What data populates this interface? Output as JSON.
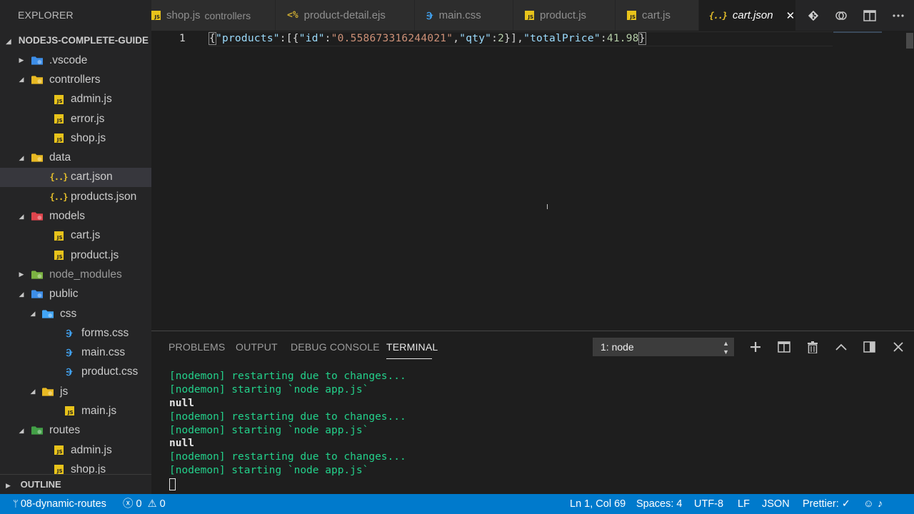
{
  "sidebar": {
    "title": "EXPLORER",
    "project": "NODEJS-COMPLETE-GUIDE",
    "outline": "OUTLINE",
    "items": [
      {
        "label": ".vscode",
        "kind": "folder-vscode",
        "icon": "vscode-folder-icon",
        "color": "#3d8ee8",
        "expanded": false
      },
      {
        "label": "controllers",
        "kind": "folder",
        "icon": "controllers-folder-icon",
        "color": "#e8b923",
        "expanded": true
      },
      {
        "label": "admin.js",
        "kind": "js",
        "icon": "js-file-icon"
      },
      {
        "label": "error.js",
        "kind": "js",
        "icon": "js-file-icon"
      },
      {
        "label": "shop.js",
        "kind": "js",
        "icon": "js-file-icon"
      },
      {
        "label": "data",
        "kind": "folder",
        "icon": "data-folder-icon",
        "color": "#e8b923",
        "expanded": true
      },
      {
        "label": "cart.json",
        "kind": "json",
        "icon": "json-file-icon",
        "selected": true
      },
      {
        "label": "products.json",
        "kind": "json",
        "icon": "json-file-icon"
      },
      {
        "label": "models",
        "kind": "folder",
        "icon": "models-folder-icon",
        "color": "#e0454d",
        "expanded": true
      },
      {
        "label": "cart.js",
        "kind": "js",
        "icon": "js-file-icon"
      },
      {
        "label": "product.js",
        "kind": "js",
        "icon": "js-file-icon"
      },
      {
        "label": "node_modules",
        "kind": "folder",
        "icon": "node-modules-folder-icon",
        "color": "#7cb342",
        "expanded": false,
        "dim": true
      },
      {
        "label": "public",
        "kind": "folder",
        "icon": "public-folder-icon",
        "color": "#3d8ee8",
        "expanded": true
      },
      {
        "label": "css",
        "kind": "folder",
        "icon": "css-folder-icon",
        "color": "#42a5f5",
        "expanded": true
      },
      {
        "label": "forms.css",
        "kind": "css",
        "icon": "css-file-icon"
      },
      {
        "label": "main.css",
        "kind": "css",
        "icon": "css-file-icon"
      },
      {
        "label": "product.css",
        "kind": "css",
        "icon": "css-file-icon"
      },
      {
        "label": "js",
        "kind": "folder",
        "icon": "js-folder-icon",
        "color": "#e8b923",
        "expanded": true
      },
      {
        "label": "main.js",
        "kind": "js",
        "icon": "js-file-icon"
      },
      {
        "label": "routes",
        "kind": "folder",
        "icon": "routes-folder-icon",
        "color": "#43a047",
        "expanded": true
      },
      {
        "label": "admin.js",
        "kind": "js",
        "icon": "js-file-icon"
      },
      {
        "label": "shop.js",
        "kind": "js",
        "icon": "js-file-icon"
      }
    ]
  },
  "tabs": [
    {
      "label": "shop.js",
      "sub": "controllers",
      "icon": "js-file-icon",
      "active": false
    },
    {
      "label": "product-detail.ejs",
      "icon": "ejs-file-icon",
      "active": false
    },
    {
      "label": "main.css",
      "icon": "css-file-icon",
      "active": false
    },
    {
      "label": "product.js",
      "icon": "js-file-icon",
      "active": false
    },
    {
      "label": "cart.js",
      "icon": "js-file-icon",
      "active": false
    },
    {
      "label": "cart.json",
      "icon": "json-file-icon",
      "active": true,
      "close": "✕"
    }
  ],
  "editor": {
    "line_number": "1",
    "tokens": [
      {
        "t": "{",
        "c": "punc",
        "bracket": true
      },
      {
        "t": "\"products\"",
        "c": "key"
      },
      {
        "t": ":[{",
        "c": "punc"
      },
      {
        "t": "\"id\"",
        "c": "key"
      },
      {
        "t": ":",
        "c": "punc"
      },
      {
        "t": "\"0.558673316244021\"",
        "c": "str"
      },
      {
        "t": ",",
        "c": "punc"
      },
      {
        "t": "\"qty\"",
        "c": "key"
      },
      {
        "t": ":",
        "c": "punc"
      },
      {
        "t": "2",
        "c": "num"
      },
      {
        "t": "}],",
        "c": "punc"
      },
      {
        "t": "\"totalPrice\"",
        "c": "key"
      },
      {
        "t": ":",
        "c": "punc"
      },
      {
        "t": "41.98",
        "c": "num"
      },
      {
        "t": "}",
        "c": "punc",
        "bracket": true
      }
    ]
  },
  "panel": {
    "tabs": [
      {
        "label": "PROBLEMS",
        "active": false
      },
      {
        "label": "OUTPUT",
        "active": false
      },
      {
        "label": "DEBUG CONSOLE",
        "active": false
      },
      {
        "label": "TERMINAL",
        "active": true
      }
    ],
    "terminal_select": "1: node",
    "terminal_lines": [
      {
        "text": "[nodemon] restarting due to changes...",
        "style": "green"
      },
      {
        "text": "[nodemon] starting `node app.js`",
        "style": "green"
      },
      {
        "text": "null",
        "style": "white"
      },
      {
        "text": "[nodemon] restarting due to changes...",
        "style": "green"
      },
      {
        "text": "[nodemon] starting `node app.js`",
        "style": "green"
      },
      {
        "text": "null",
        "style": "white"
      },
      {
        "text": "[nodemon] restarting due to changes...",
        "style": "green"
      },
      {
        "text": "[nodemon] starting `node app.js`",
        "style": "green"
      }
    ]
  },
  "statusbar": {
    "branch": "08-dynamic-routes",
    "errors": "0",
    "warnings": "0",
    "position": "Ln 1, Col 69",
    "spaces": "Spaces: 4",
    "encoding": "UTF-8",
    "eol": "LF",
    "language": "JSON",
    "prettier": "Prettier: ✓"
  },
  "colors": {
    "accent": "#007acc",
    "terminal_green": "#23d18b",
    "json_key": "#9cdcfe",
    "json_string": "#ce9178",
    "json_number": "#b5cea8"
  }
}
